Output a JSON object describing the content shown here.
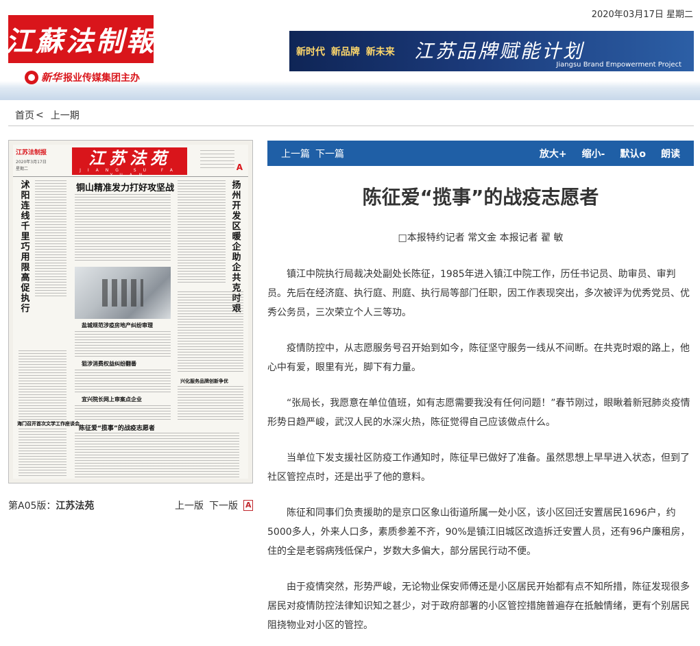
{
  "header": {
    "date": "2020年03月17日 星期二",
    "logo_text": "江蘇法制報",
    "sponsor_brand": "新华",
    "sponsor_text": "报业传媒集团主办",
    "banner": {
      "slogan1": "新时代",
      "slogan2": "新品牌",
      "slogan3": "新未来",
      "title": "江苏品牌赋能计划",
      "subtitle": "Jiangsu Brand Empowerment Project"
    }
  },
  "nav": {
    "home": "首页",
    "separator": "<",
    "prev_issue": "上一期"
  },
  "thumbnail": {
    "masthead": "江苏法苑",
    "masthead_sub": "JIANG SU FA YUAN",
    "small_logo": "江苏法制报",
    "date": "2020年3月17日",
    "weekday": "星期二",
    "page_letter": "A",
    "left_vertical_headline": "沭阳连线千里巧用限高促执行",
    "right_vertical_headline": "扬州开发区暖企助企共克时艰",
    "main_headline": "铜山精准发力打好攻坚战",
    "headline2": "盐城规范涉疫房地产纠纷审理",
    "headline3": "狙涉消费权益纠纷翻番",
    "headline4": "宜兴院长网上审案点企业",
    "headline5": "陈征爱“揽事”的战疫志愿者",
    "side_headline1": "海门召开首次文学工作座谈会",
    "side_headline2": "兴化服务品牌创新争优"
  },
  "edition": {
    "number": "第A05版：",
    "name": "江苏法苑",
    "prev_edition": "上一版",
    "next_edition": "下一版"
  },
  "toolbar": {
    "prev_article": "上一篇",
    "next_article": "下一篇",
    "zoom_in": "放大+",
    "zoom_out": "缩小-",
    "default": "默认o",
    "read_aloud": "朗读"
  },
  "article": {
    "title": "陈征爱“揽事”的战疫志愿者",
    "byline": "□本报特约记者 常文金 本报记者 翟 敏",
    "paragraphs": [
      "镇江中院执行局裁决处副处长陈征，1985年进入镇江中院工作，历任书记员、助审员、审判员。先后在经济庭、执行庭、刑庭、执行局等部门任职，因工作表现突出，多次被评为优秀党员、优秀公务员，三次荣立个人三等功。",
      "疫情防控中，从志愿服务号召开始到如今，陈征坚守服务一线从不间断。在共克时艰的路上，他心中有爱，眼里有光，脚下有力量。",
      "“张局长，我愿意在单位值班，如有志愿需要我没有任何问题！”春节刚过，眼瞅着新冠肺炎疫情形势日趋严峻，武汉人民的水深火热，陈征觉得自己应该做点什么。",
      "当单位下发支援社区防疫工作通知时，陈征早已做好了准备。虽然思想上早早进入状态，但到了社区管控点时，还是出乎了他的意料。",
      "陈征和同事们负责援助的是京口区象山街道所属一处小区，该小区回迁安置居民1696户，约5000多人，外来人口多，素质参差不齐，90%是镇江旧城区改造拆迁安置人员，还有96户廉租房，住的全是老弱病残低保户，岁数大多偏大，部分居民行动不便。",
      "由于疫情突然，形势严峻，无论物业保安师傅还是小区居民开始都有点不知所措，陈征发现很多居民对疫情防控法律知识知之甚少，对于政府部署的小区管控措施普遍存在抵触情绪，更有个别居民阻挠物业对小区的管控。"
    ]
  }
}
